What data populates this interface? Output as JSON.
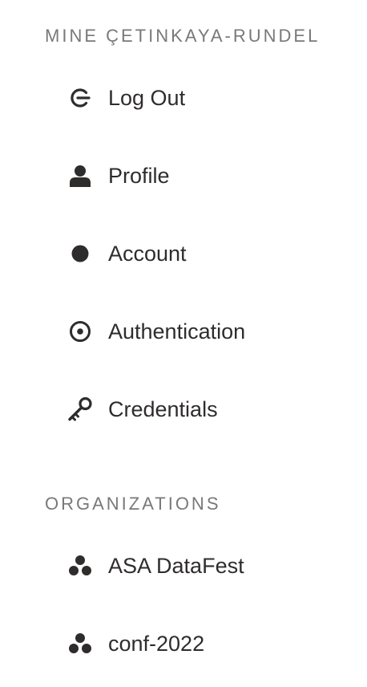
{
  "user_section": {
    "heading": "MINE ÇETINKAYA-RUNDEL",
    "items": [
      {
        "label": "Log Out",
        "icon": "logout-icon"
      },
      {
        "label": "Profile",
        "icon": "user-icon"
      },
      {
        "label": "Account",
        "icon": "filled-circle-icon"
      },
      {
        "label": "Authentication",
        "icon": "target-circle-icon"
      },
      {
        "label": "Credentials",
        "icon": "key-icon"
      }
    ]
  },
  "organizations_section": {
    "heading": "ORGANIZATIONS",
    "items": [
      {
        "label": "ASA DataFest",
        "icon": "organization-icon"
      },
      {
        "label": "conf-2022",
        "icon": "organization-icon"
      }
    ]
  },
  "colors": {
    "text": "#2f2c2c",
    "heading": "#7a7878",
    "background": "#ffffff"
  }
}
